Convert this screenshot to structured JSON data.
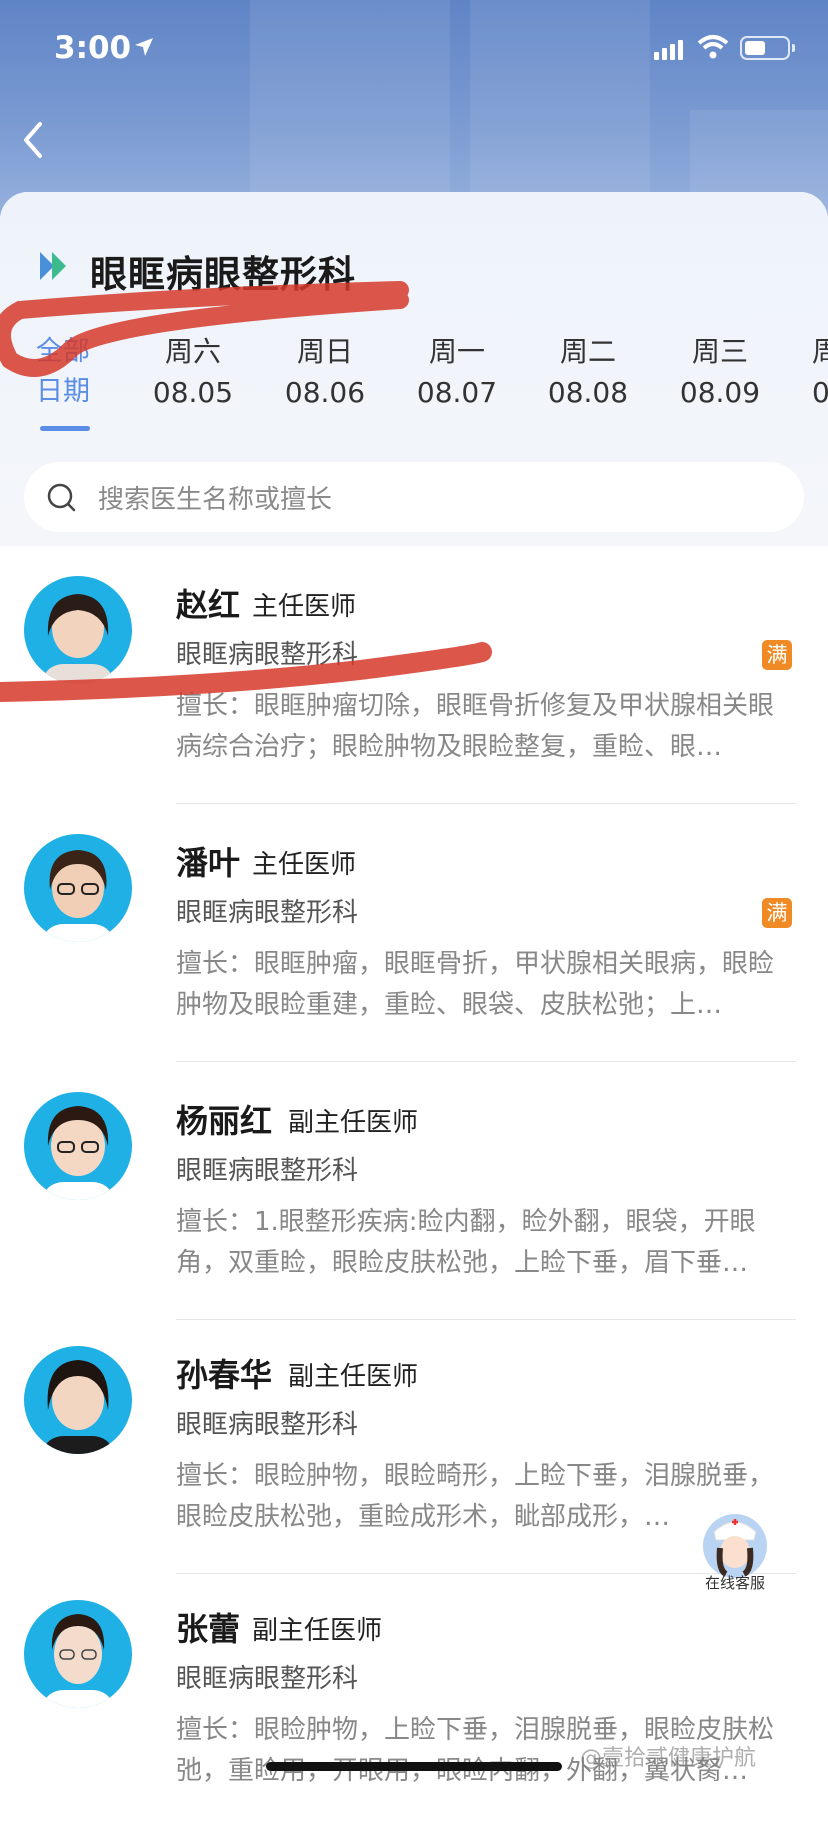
{
  "status_bar": {
    "time": "3:00"
  },
  "header": {
    "department_title": "眼眶病眼整形科"
  },
  "date_tabs": {
    "all_label_line1": "全部",
    "all_label_line2": "日期",
    "days": [
      {
        "weekday": "周六",
        "date": "08.05"
      },
      {
        "weekday": "周日",
        "date": "08.06"
      },
      {
        "weekday": "周一",
        "date": "08.07"
      },
      {
        "weekday": "周二",
        "date": "08.08"
      },
      {
        "weekday": "周三",
        "date": "08.09"
      },
      {
        "weekday": "周",
        "date": "0"
      }
    ]
  },
  "search": {
    "placeholder": "搜索医生名称或擅长"
  },
  "doctors": [
    {
      "name": "赵红",
      "title": "主任医师",
      "department": "眼眶病眼整形科",
      "badge": "满",
      "specialty": "擅长：眼眶肿瘤切除，眼眶骨折修复及甲状腺相关眼病综合治疗；眼睑肿物及眼睑整复，重睑、眼…"
    },
    {
      "name": "潘叶",
      "title": "主任医师",
      "department": "眼眶病眼整形科",
      "badge": "满",
      "specialty": "擅长：眼眶肿瘤，眼眶骨折，甲状腺相关眼病，眼睑肿物及眼睑重建，重睑、眼袋、皮肤松弛；上…"
    },
    {
      "name": "杨丽红",
      "title": "副主任医师",
      "department": "眼眶病眼整形科",
      "badge": "",
      "specialty": "擅长：1.眼整形疾病:睑内翻，睑外翻，眼袋，开眼角，双重睑，眼睑皮肤松弛，上睑下垂，眉下垂…"
    },
    {
      "name": "孙春华",
      "title": "副主任医师",
      "department": "眼眶病眼整形科",
      "badge": "",
      "specialty": "擅长：眼睑肿物，眼睑畸形，上睑下垂，泪腺脱垂，眼睑皮肤松弛，重睑成形术，眦部成形，…"
    },
    {
      "name": "张蕾",
      "title": "副主任医师",
      "department": "眼眶病眼整形科",
      "badge": "",
      "specialty": "擅长：眼睑肿物，上睑下垂，泪腺脱垂，眼睑皮肤松弛，重睑用，开眼用，眼睑内翻，外翻，翼状胬…"
    }
  ],
  "customer_service": {
    "label": "在线客服"
  },
  "watermark": "@壹拾贰健康护航",
  "colors": {
    "accent": "#5b8de6",
    "badge": "#f08a24",
    "avatar_bg": "#1fb0e6",
    "scribble": "#d63a2a"
  }
}
